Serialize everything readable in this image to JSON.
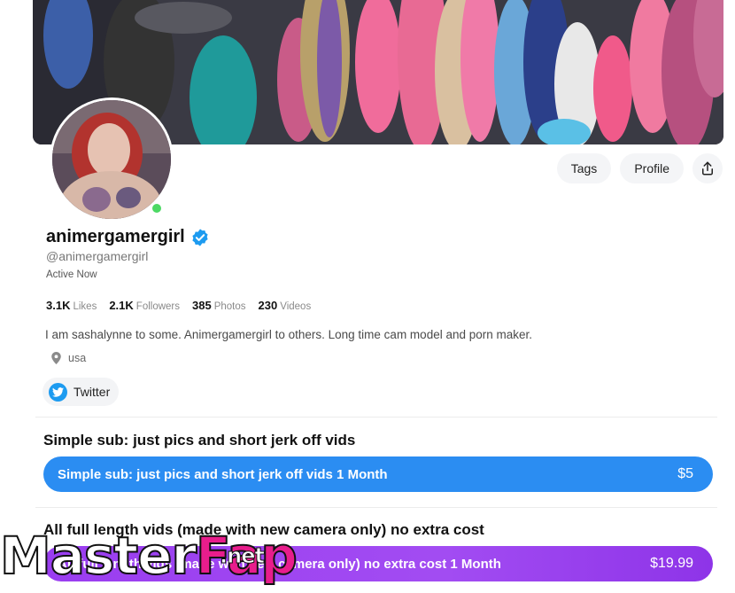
{
  "profile": {
    "name": "animergamergirl",
    "handle": "@animergamergirl",
    "status": "Active Now",
    "bio": "I am sashalynne to some. Animergamergirl to others. Long time cam model and porn maker.",
    "location": "usa",
    "verified": true
  },
  "actions": {
    "tags_label": "Tags",
    "profile_label": "Profile",
    "share_icon": "share-icon"
  },
  "stats": [
    {
      "value": "3.1K",
      "label": "Likes"
    },
    {
      "value": "2.1K",
      "label": "Followers"
    },
    {
      "value": "385",
      "label": "Photos"
    },
    {
      "value": "230",
      "label": "Videos"
    }
  ],
  "social": {
    "label": "Twitter",
    "icon": "twitter-icon"
  },
  "tiers": [
    {
      "title": "Simple sub: just pics and short jerk off vids",
      "button_label": "Simple sub: just pics and short jerk off vids 1 Month",
      "price": "$5",
      "color": "#2b8df2"
    },
    {
      "title": "All full length vids (made with new camera only) no extra cost",
      "button_label": "All full length vids (made with new camera only) no extra cost 1 Month",
      "price": "$19.99",
      "color": "#9a3df0"
    }
  ],
  "watermark": {
    "master": "Master",
    "fap": "Fap",
    "net": ".net"
  },
  "colors": {
    "online": "#4cd964",
    "verified": "#1d9bf0",
    "accent_pink": "#e81d8c"
  }
}
